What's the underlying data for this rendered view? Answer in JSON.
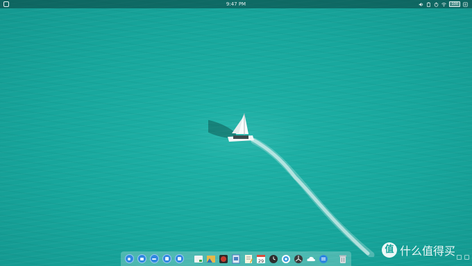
{
  "top_panel": {
    "clock": "9:47 PM",
    "battery": "100",
    "tray_icons": [
      "volume-icon",
      "clipboard-icon",
      "power-icon",
      "wifi-icon",
      "battery-icon",
      "settings-icon"
    ]
  },
  "watermark": {
    "logo_glyph": "值",
    "text": "什么值得买"
  },
  "dock": {
    "calendar_day": "29",
    "items": [
      "launcher-icon",
      "workspace-icon",
      "apps-grid-icon",
      "multitask-icon",
      "notes-menu-icon",
      "file-manager-icon",
      "photos-icon",
      "music-player-icon",
      "document-viewer-icon",
      "text-editor-icon",
      "calendar-icon",
      "clock-icon",
      "browser-icon",
      "system-monitor-icon",
      "cloud-icon",
      "chat-icon",
      "trash-icon"
    ]
  },
  "colors": {
    "sea": "#17a69c",
    "panel": "#0a3c3a",
    "accent_blue": "#2f88e0"
  }
}
